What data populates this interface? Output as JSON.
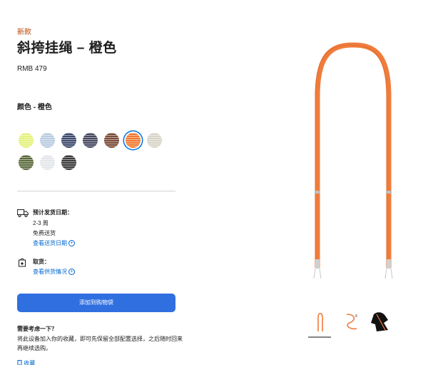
{
  "product": {
    "badge": "新款",
    "title": "斜挎挂绳 – 橙色",
    "price": "RMB 479",
    "color_label": "颜色 - 橙色"
  },
  "swatches": [
    {
      "name": "swatch-yellow-green",
      "color": "#e4f27a",
      "selected": false
    },
    {
      "name": "swatch-light-blue",
      "color": "#b9cbe0",
      "selected": false
    },
    {
      "name": "swatch-navy",
      "color": "#3c4a6b",
      "selected": false
    },
    {
      "name": "swatch-dark-purple",
      "color": "#45475e",
      "selected": false
    },
    {
      "name": "swatch-brown",
      "color": "#7a4a38",
      "selected": false
    },
    {
      "name": "swatch-orange",
      "color": "#f2772e",
      "selected": true
    },
    {
      "name": "swatch-beige",
      "color": "#d8d4c8",
      "selected": false
    },
    {
      "name": "swatch-olive",
      "color": "#5b6a3c",
      "selected": false
    },
    {
      "name": "swatch-white",
      "color": "#e3e6ea",
      "selected": false
    },
    {
      "name": "swatch-black",
      "color": "#3a3a3c",
      "selected": false
    }
  ],
  "delivery": {
    "title": "预计发货日期：",
    "line1": "2-3 周",
    "line2": "免费送货",
    "link": "查看送货日期"
  },
  "pickup": {
    "title": "取货：",
    "link": "查看供货情况"
  },
  "add_to_bag": "添加到购物袋",
  "consider": {
    "title": "需要考虑一下？",
    "text": "将此设备加入你的收藏，即可先保留全部配置选择，之后随时回来再继续选购。",
    "save": "收藏"
  },
  "colors": {
    "accent": "#2f6fe0",
    "link": "#0066cc",
    "strap": "#f07c3c",
    "badge": "#b64400"
  },
  "icons": [
    "truck-icon",
    "apple-store-icon",
    "plus-circle-icon",
    "bookmark-icon"
  ]
}
